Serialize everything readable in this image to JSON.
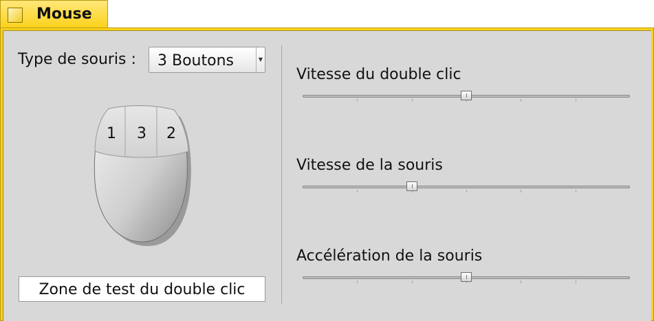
{
  "window": {
    "title": "Mouse"
  },
  "mouse_type": {
    "label": "Type de souris :",
    "value": "3 Boutons"
  },
  "mouse_buttons": [
    "1",
    "3",
    "2"
  ],
  "test_zone": {
    "label": "Zone de test du double clic"
  },
  "sliders": [
    {
      "label": "Vitesse du double clic",
      "value": 0.5
    },
    {
      "label": "Vitesse de la souris",
      "value": 0.333
    },
    {
      "label": "Accélération de la souris",
      "value": 0.5
    }
  ],
  "colors": {
    "title_tab": "#fcd21c",
    "panel": "#d8d8d8"
  },
  "icons": {
    "zoom": "zoom-box-icon",
    "select_arrow": "chevron-down-icon"
  }
}
